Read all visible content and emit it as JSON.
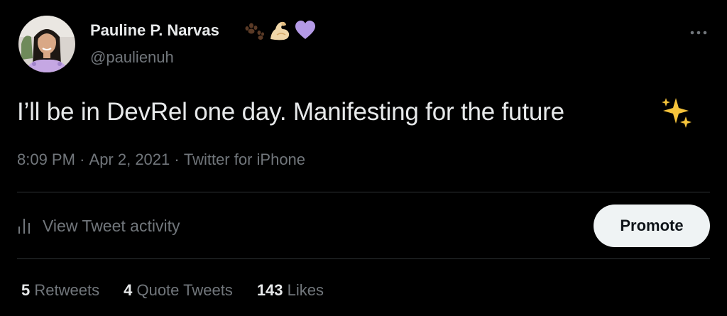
{
  "author": {
    "name": "Pauline P. Narvas",
    "name_emoji_icons": [
      "paw-prints-icon",
      "flexed-biceps-icon",
      "purple-heart-icon"
    ],
    "handle": "@paulienuh"
  },
  "tweet": {
    "text": "I’ll be in DevRel one day. Manifesting for the future",
    "text_emoji_icon": "sparkles-icon"
  },
  "meta": {
    "time": "8:09 PM",
    "separator": "·",
    "date": "Apr 2, 2021",
    "source": "Twitter for iPhone"
  },
  "actions": {
    "activity_label": "View Tweet activity",
    "promote_label": "Promote"
  },
  "stats": {
    "retweets_count": "5",
    "retweets_label": "Retweets",
    "quotes_count": "4",
    "quotes_label": "Quote Tweets",
    "likes_count": "143",
    "likes_label": "Likes"
  },
  "colors": {
    "background": "#000000",
    "primary_text": "#e7e9ea",
    "secondary_text": "#71767b",
    "divider": "#2f3336",
    "promote_bg": "#eff3f4",
    "promote_text": "#0f1419",
    "purple_heart": "#b49ae6",
    "sparkle": "#f5c33b"
  }
}
